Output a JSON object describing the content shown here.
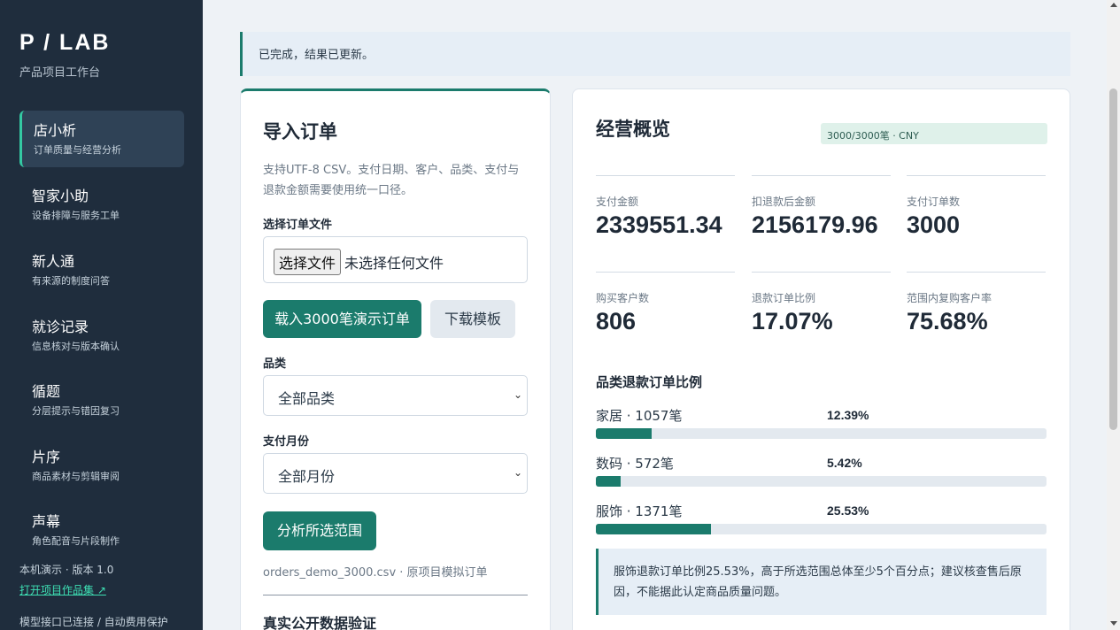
{
  "sidebar": {
    "brand": "P / LAB",
    "brand_sub": "产品项目工作台",
    "items": [
      {
        "title": "店小析",
        "sub": "订单质量与经营分析"
      },
      {
        "title": "智家小助",
        "sub": "设备排障与服务工单"
      },
      {
        "title": "新人通",
        "sub": "有来源的制度问答"
      },
      {
        "title": "就诊记录",
        "sub": "信息核对与版本确认"
      },
      {
        "title": "循题",
        "sub": "分层提示与错因复习"
      },
      {
        "title": "片序",
        "sub": "商品素材与剪辑审阅"
      },
      {
        "title": "声幕",
        "sub": "角色配音与片段制作"
      }
    ],
    "version": "本机演示 · 版本 1.0",
    "portfolio_link": "打开项目作品集 ↗",
    "status": "模型接口已连接 / 自动费用保护"
  },
  "notice": "已完成，结果已更新。",
  "import": {
    "title": "导入订单",
    "desc": "支持UTF-8 CSV。支付日期、客户、品类、支付与退款金额需要使用统一口径。",
    "file_label": "选择订单文件",
    "file_button": "选择文件",
    "file_status": "未选择任何文件",
    "load_demo": "载入3000笔演示订单",
    "download_template": "下载模板",
    "category_label": "品类",
    "category_value": "全部品类",
    "month_label": "支付月份",
    "month_value": "全部月份",
    "analyze": "分析所选范围",
    "file_note": "orders_demo_3000.csv · 原项目模拟订单",
    "verify_title": "真实公开数据验证"
  },
  "overview": {
    "title": "经营概览",
    "badge": "3000/3000笔 · CNY",
    "metrics": [
      {
        "label": "支付金额",
        "value": "2339551.34"
      },
      {
        "label": "扣退款后金额",
        "value": "2156179.96"
      },
      {
        "label": "支付订单数",
        "value": "3000"
      },
      {
        "label": "购买客户数",
        "value": "806"
      },
      {
        "label": "退款订单比例",
        "value": "17.07%"
      },
      {
        "label": "范围内复购客户率",
        "value": "75.68%"
      }
    ],
    "refund_title": "品类退款订单比例",
    "insight": "服饰退款订单比例25.53%，高于所选范围总体至少5个百分点；建议核查售后原因，不能据此认定商品质量问题。"
  },
  "chart_data": {
    "type": "bar",
    "title": "品类退款订单比例",
    "categories": [
      "家居 · 1057笔",
      "数码 · 572笔",
      "服饰 · 1371笔"
    ],
    "values": [
      12.39,
      5.42,
      25.53
    ],
    "value_labels": [
      "12.39%",
      "5.42%",
      "25.53%"
    ],
    "ylim": [
      0,
      100
    ],
    "color": "#1b7b6c"
  },
  "colors": {
    "sidebar_bg": "#1f2d3d",
    "accent": "#1b7b6c",
    "active_border": "#34c9a3",
    "page_bg": "#eef2f6"
  }
}
